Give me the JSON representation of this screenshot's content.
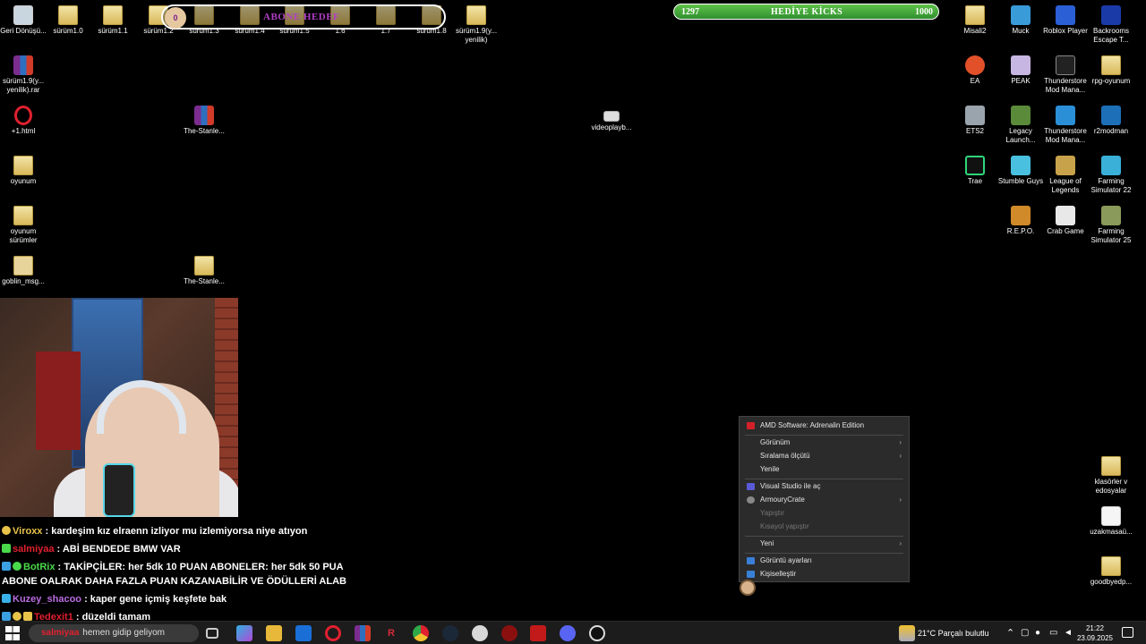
{
  "overlays": {
    "abone": {
      "count": "0",
      "title": "ABONE HEDEF"
    },
    "kicks": {
      "left": "1297",
      "title": "HEDİYE KİCKS",
      "right": "1000",
      "color": "#3aa83a"
    }
  },
  "desktop_icons": {
    "recycle": "Geri Dönüşü...",
    "s10": "sürüm1.0",
    "s11": "sürüm1.1",
    "s12": "sürüm1.2",
    "s13": "sürüm1.3",
    "s14": "sürüm1.4",
    "s15": "sürüm1.5",
    "s16": "1.6",
    "s17": "1.7",
    "s18": "sürüm1.8",
    "s19": "sürüm1.9(y... yenilik)",
    "rar": "sürüm1.9(y... yenilik).rar",
    "html": "+1.html",
    "stanley1": "The-Stanle...",
    "video": "videoplayb...",
    "oyunum": "oyunum",
    "oyunum_surumler": "oyunum sürümler",
    "goblin": "goblin_msg...",
    "stanley2": "The-Stanle...",
    "misali": "Misali2",
    "muck": "Muck",
    "roblox": "Roblox Player",
    "backrooms": "Backrooms Escape T...",
    "ea": "EA",
    "peak": "PEAK",
    "thunder1": "Thunderstore Mod Mana...",
    "rpg": "rpg-oyunum",
    "ets2": "ETS2",
    "legacy": "Legacy Launch...",
    "thunder2": "Thunderstore Mod Mana...",
    "r2mod": "r2modman",
    "trae": "Trae",
    "stumble": "Stumble Guys",
    "lol": "League of Legends",
    "fs22": "Farming Simulator 22",
    "repo": "R.E.P.O.",
    "crab": "Crab Game",
    "fs25": "Farming Simulator 25",
    "klasorler": "klasörler v edosyalar",
    "uzak": "uzakmasaü...",
    "goodbye": "goodbyedp..."
  },
  "chat": [
    {
      "user": "Viroxx",
      "color": "#e8c34a",
      "text": " : kardeşim kız elraenn izliyor mu izlemiyorsa niye atıyon"
    },
    {
      "user": "salmiyaa",
      "color": "#e0202f",
      "text": " : ABİ BENDEDE BMW VAR"
    },
    {
      "user": "BotRix",
      "color": "#4ad94a",
      "text": " : TAKİPÇİLER: her 5dk 10 PUAN ABONELER: her 5dk 50 PUA"
    },
    {
      "user": "",
      "color": "#ffffff",
      "text": "ABONE OALRAK DAHA FAZLA PUAN KAZANABİLİR VE ÖDÜLLERİ ALAB"
    },
    {
      "user": "Kuzey_shacoo",
      "color": "#b86be0",
      "text": " : kaper gene içmiş keşfete bak"
    },
    {
      "user": "Tedexit1",
      "color": "#e0202f",
      "text": " : düzeldi tamam"
    }
  ],
  "context_menu": {
    "amd": "AMD Software: Adrenalin Edition",
    "view": "Görünüm",
    "sort": "Sıralama ölçütü",
    "refresh": "Yenile",
    "vs": "Visual Studio ile aç",
    "armoury": "ArmouryCrate",
    "paste": "Yapıştır",
    "paste_shortcut": "Kısayol yapıştır",
    "new": "Yeni",
    "display": "Görüntü ayarları",
    "personalize": "Kişiselleştir"
  },
  "taskbar": {
    "search_user": "salmiyaa",
    "search_text": "hemen gidip geliyom",
    "weather": "21°C  Parçalı bulutlu",
    "time": "21:22",
    "date": "23.09.2025"
  }
}
